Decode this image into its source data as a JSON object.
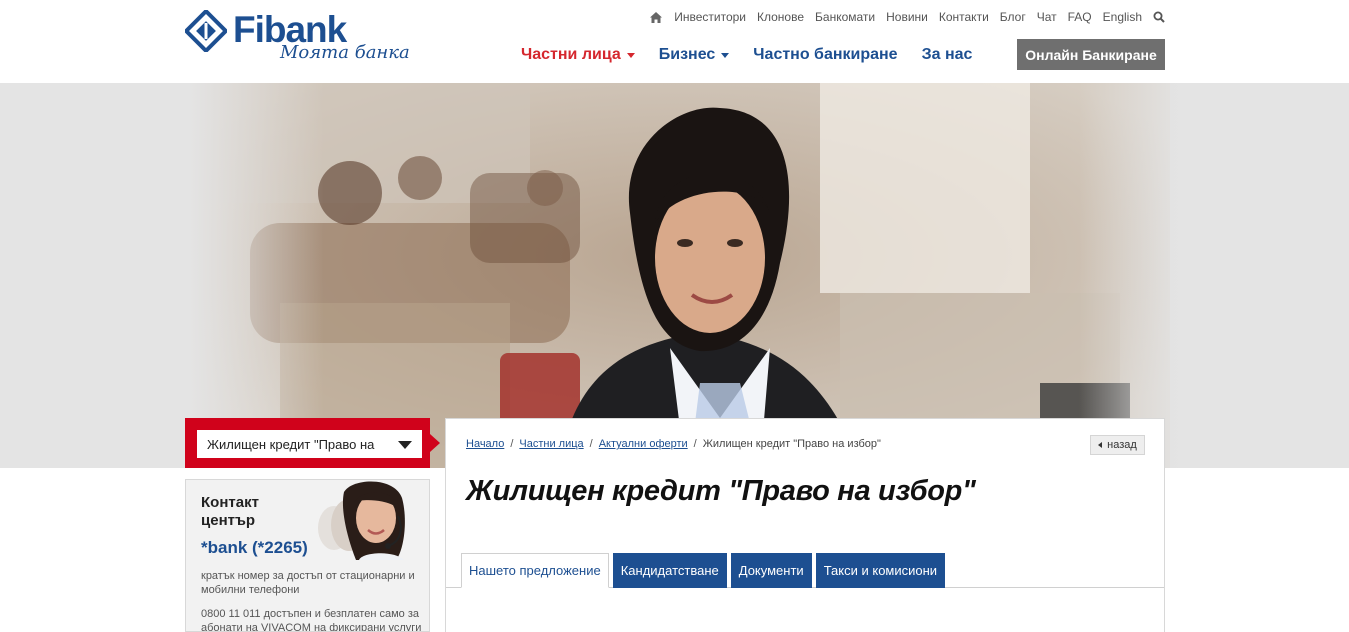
{
  "brand": {
    "name": "Fibank",
    "slogan": "Моята банка",
    "color": "#1d4f91",
    "accent": "#d5272e"
  },
  "top_links": [
    "Инвеститори",
    "Клонове",
    "Банкомати",
    "Новини",
    "Контакти",
    "Блог",
    "Чат",
    "FAQ",
    "English"
  ],
  "main_nav": {
    "items": [
      "Частни лица",
      "Бизнес",
      "Частно банкиране",
      "За нас"
    ],
    "online_banking": "Онлайн Банкиране"
  },
  "sidebar": {
    "product_select": "Жилищен кредит \"Право на",
    "contact": {
      "title": "Контакт център",
      "phone": "*bank (*2265)",
      "note1": "кратък номер за достъп от стационарни и мобилни телефони",
      "note2": "0800 11 011 достъпен и безплатен само за абонати на VIVACOM на фиксирани услуги"
    }
  },
  "content": {
    "breadcrumb": [
      "Начало",
      "Частни лица",
      "Актуални оферти",
      "Жилищен кредит \"Право на избор\""
    ],
    "back_label": "назад",
    "title": "Жилищен кредит \"Право на избор\"",
    "tabs": [
      "Нашето предложение",
      "Кандидатстване",
      "Документи",
      "Такси и комисиони"
    ]
  },
  "icons": {
    "home": "home-icon",
    "search": "search-icon",
    "dropdown": "chevron-down-icon",
    "back": "arrow-left-icon"
  }
}
